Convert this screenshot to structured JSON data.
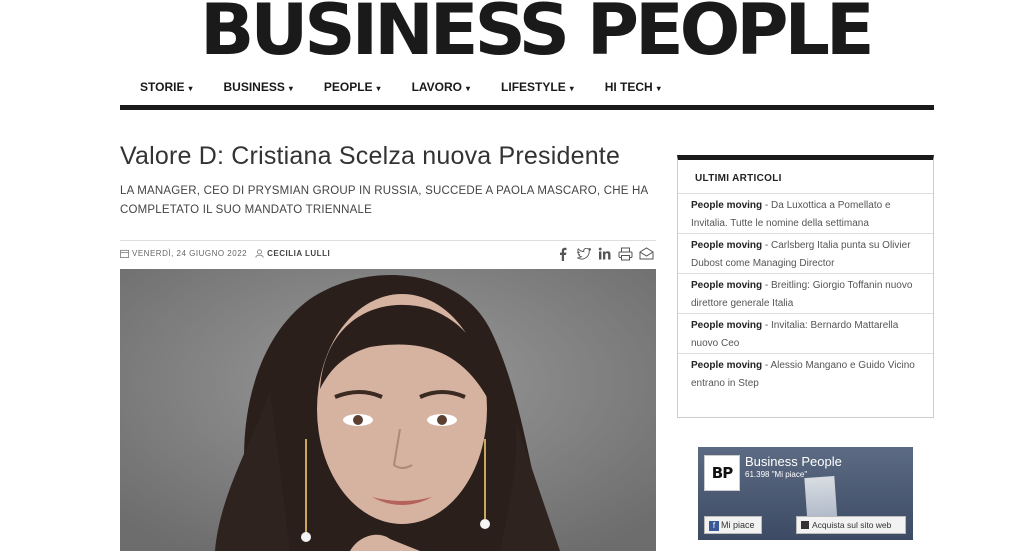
{
  "logo": "BUSINESS PEOPLE",
  "nav": [
    "STORIE",
    "BUSINESS",
    "PEOPLE",
    "LAVORO",
    "LIFESTYLE",
    "HI TECH"
  ],
  "nav_caret": "▾",
  "article": {
    "title": "Valore D: Cristiana Scelza nuova Presidente",
    "subtitle": "La manager, Ceo di Prysmian Group in Russia, succede a Paola Mascaro, che ha completato il suo mandato triennale",
    "date": "VENERDÌ, 24 GIUGNO 2022",
    "author": "CECILIA LULLI"
  },
  "sidebar": {
    "heading": "ULTIMI ARTICOLI",
    "items": [
      {
        "tag": "People moving",
        "text": " - Da Luxottica a Pomellato e Invitalia. Tutte le nomine della settimana"
      },
      {
        "tag": "People moving",
        "text": " - Carlsberg Italia punta su Olivier Dubost come Managing Director"
      },
      {
        "tag": "People moving",
        "text": " - Breitling: Giorgio Toffanin nuovo direttore generale Italia"
      },
      {
        "tag": "People moving",
        "text": " - Invitalia: Bernardo Mattarella nuovo Ceo"
      },
      {
        "tag": "People moving",
        "text": " - Alessio Mangano e Guido Vicino entrano in Step"
      }
    ]
  },
  "fb_widget": {
    "badge": "BP",
    "page_name": "Business People",
    "likes": "61.398 \"Mi piace\"",
    "like_button": "Mi piace",
    "buy_button": "Acquista sul sito web"
  }
}
